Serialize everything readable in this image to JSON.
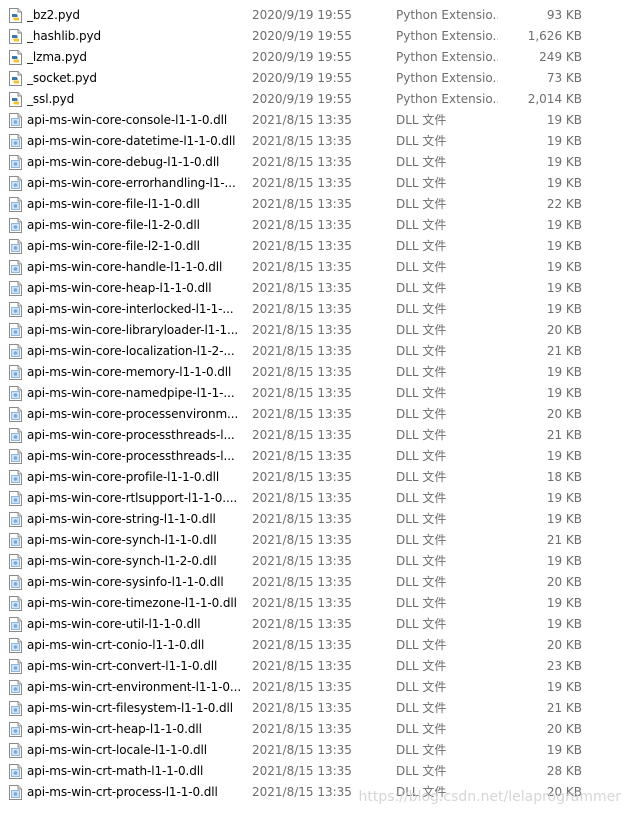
{
  "files": [
    {
      "name": "_bz2.pyd",
      "date": "2020/9/19 19:55",
      "type": "Python Extensio...",
      "size": "93 KB",
      "icon": "python-extension-icon"
    },
    {
      "name": "_hashlib.pyd",
      "date": "2020/9/19 19:55",
      "type": "Python Extensio...",
      "size": "1,626 KB",
      "icon": "python-extension-icon"
    },
    {
      "name": "_lzma.pyd",
      "date": "2020/9/19 19:55",
      "type": "Python Extensio...",
      "size": "249 KB",
      "icon": "python-extension-icon"
    },
    {
      "name": "_socket.pyd",
      "date": "2020/9/19 19:55",
      "type": "Python Extensio...",
      "size": "73 KB",
      "icon": "python-extension-icon"
    },
    {
      "name": "_ssl.pyd",
      "date": "2020/9/19 19:55",
      "type": "Python Extensio...",
      "size": "2,014 KB",
      "icon": "python-extension-icon"
    },
    {
      "name": "api-ms-win-core-console-l1-1-0.dll",
      "date": "2021/8/15 13:35",
      "type": "DLL 文件",
      "size": "19 KB",
      "icon": "dll-file-icon"
    },
    {
      "name": "api-ms-win-core-datetime-l1-1-0.dll",
      "date": "2021/8/15 13:35",
      "type": "DLL 文件",
      "size": "19 KB",
      "icon": "dll-file-icon"
    },
    {
      "name": "api-ms-win-core-debug-l1-1-0.dll",
      "date": "2021/8/15 13:35",
      "type": "DLL 文件",
      "size": "19 KB",
      "icon": "dll-file-icon"
    },
    {
      "name": "api-ms-win-core-errorhandling-l1-...",
      "date": "2021/8/15 13:35",
      "type": "DLL 文件",
      "size": "19 KB",
      "icon": "dll-file-icon"
    },
    {
      "name": "api-ms-win-core-file-l1-1-0.dll",
      "date": "2021/8/15 13:35",
      "type": "DLL 文件",
      "size": "22 KB",
      "icon": "dll-file-icon"
    },
    {
      "name": "api-ms-win-core-file-l1-2-0.dll",
      "date": "2021/8/15 13:35",
      "type": "DLL 文件",
      "size": "19 KB",
      "icon": "dll-file-icon"
    },
    {
      "name": "api-ms-win-core-file-l2-1-0.dll",
      "date": "2021/8/15 13:35",
      "type": "DLL 文件",
      "size": "19 KB",
      "icon": "dll-file-icon"
    },
    {
      "name": "api-ms-win-core-handle-l1-1-0.dll",
      "date": "2021/8/15 13:35",
      "type": "DLL 文件",
      "size": "19 KB",
      "icon": "dll-file-icon"
    },
    {
      "name": "api-ms-win-core-heap-l1-1-0.dll",
      "date": "2021/8/15 13:35",
      "type": "DLL 文件",
      "size": "19 KB",
      "icon": "dll-file-icon"
    },
    {
      "name": "api-ms-win-core-interlocked-l1-1-...",
      "date": "2021/8/15 13:35",
      "type": "DLL 文件",
      "size": "19 KB",
      "icon": "dll-file-icon"
    },
    {
      "name": "api-ms-win-core-libraryloader-l1-1...",
      "date": "2021/8/15 13:35",
      "type": "DLL 文件",
      "size": "20 KB",
      "icon": "dll-file-icon"
    },
    {
      "name": "api-ms-win-core-localization-l1-2-...",
      "date": "2021/8/15 13:35",
      "type": "DLL 文件",
      "size": "21 KB",
      "icon": "dll-file-icon"
    },
    {
      "name": "api-ms-win-core-memory-l1-1-0.dll",
      "date": "2021/8/15 13:35",
      "type": "DLL 文件",
      "size": "19 KB",
      "icon": "dll-file-icon"
    },
    {
      "name": "api-ms-win-core-namedpipe-l1-1-...",
      "date": "2021/8/15 13:35",
      "type": "DLL 文件",
      "size": "19 KB",
      "icon": "dll-file-icon"
    },
    {
      "name": "api-ms-win-core-processenvironm...",
      "date": "2021/8/15 13:35",
      "type": "DLL 文件",
      "size": "20 KB",
      "icon": "dll-file-icon"
    },
    {
      "name": "api-ms-win-core-processthreads-l...",
      "date": "2021/8/15 13:35",
      "type": "DLL 文件",
      "size": "21 KB",
      "icon": "dll-file-icon"
    },
    {
      "name": "api-ms-win-core-processthreads-l...",
      "date": "2021/8/15 13:35",
      "type": "DLL 文件",
      "size": "19 KB",
      "icon": "dll-file-icon"
    },
    {
      "name": "api-ms-win-core-profile-l1-1-0.dll",
      "date": "2021/8/15 13:35",
      "type": "DLL 文件",
      "size": "18 KB",
      "icon": "dll-file-icon"
    },
    {
      "name": "api-ms-win-core-rtlsupport-l1-1-0....",
      "date": "2021/8/15 13:35",
      "type": "DLL 文件",
      "size": "19 KB",
      "icon": "dll-file-icon"
    },
    {
      "name": "api-ms-win-core-string-l1-1-0.dll",
      "date": "2021/8/15 13:35",
      "type": "DLL 文件",
      "size": "19 KB",
      "icon": "dll-file-icon"
    },
    {
      "name": "api-ms-win-core-synch-l1-1-0.dll",
      "date": "2021/8/15 13:35",
      "type": "DLL 文件",
      "size": "21 KB",
      "icon": "dll-file-icon"
    },
    {
      "name": "api-ms-win-core-synch-l1-2-0.dll",
      "date": "2021/8/15 13:35",
      "type": "DLL 文件",
      "size": "19 KB",
      "icon": "dll-file-icon"
    },
    {
      "name": "api-ms-win-core-sysinfo-l1-1-0.dll",
      "date": "2021/8/15 13:35",
      "type": "DLL 文件",
      "size": "20 KB",
      "icon": "dll-file-icon"
    },
    {
      "name": "api-ms-win-core-timezone-l1-1-0.dll",
      "date": "2021/8/15 13:35",
      "type": "DLL 文件",
      "size": "19 KB",
      "icon": "dll-file-icon"
    },
    {
      "name": "api-ms-win-core-util-l1-1-0.dll",
      "date": "2021/8/15 13:35",
      "type": "DLL 文件",
      "size": "19 KB",
      "icon": "dll-file-icon"
    },
    {
      "name": "api-ms-win-crt-conio-l1-1-0.dll",
      "date": "2021/8/15 13:35",
      "type": "DLL 文件",
      "size": "20 KB",
      "icon": "dll-file-icon"
    },
    {
      "name": "api-ms-win-crt-convert-l1-1-0.dll",
      "date": "2021/8/15 13:35",
      "type": "DLL 文件",
      "size": "23 KB",
      "icon": "dll-file-icon"
    },
    {
      "name": "api-ms-win-crt-environment-l1-1-0...",
      "date": "2021/8/15 13:35",
      "type": "DLL 文件",
      "size": "19 KB",
      "icon": "dll-file-icon"
    },
    {
      "name": "api-ms-win-crt-filesystem-l1-1-0.dll",
      "date": "2021/8/15 13:35",
      "type": "DLL 文件",
      "size": "21 KB",
      "icon": "dll-file-icon"
    },
    {
      "name": "api-ms-win-crt-heap-l1-1-0.dll",
      "date": "2021/8/15 13:35",
      "type": "DLL 文件",
      "size": "20 KB",
      "icon": "dll-file-icon"
    },
    {
      "name": "api-ms-win-crt-locale-l1-1-0.dll",
      "date": "2021/8/15 13:35",
      "type": "DLL 文件",
      "size": "19 KB",
      "icon": "dll-file-icon"
    },
    {
      "name": "api-ms-win-crt-math-l1-1-0.dll",
      "date": "2021/8/15 13:35",
      "type": "DLL 文件",
      "size": "28 KB",
      "icon": "dll-file-icon"
    },
    {
      "name": "api-ms-win-crt-process-l1-1-0.dll",
      "date": "2021/8/15 13:35",
      "type": "DLL 文件",
      "size": "20 KB",
      "icon": "dll-file-icon"
    }
  ],
  "watermark": "https://blog.csdn.net/lelaprogrammer"
}
